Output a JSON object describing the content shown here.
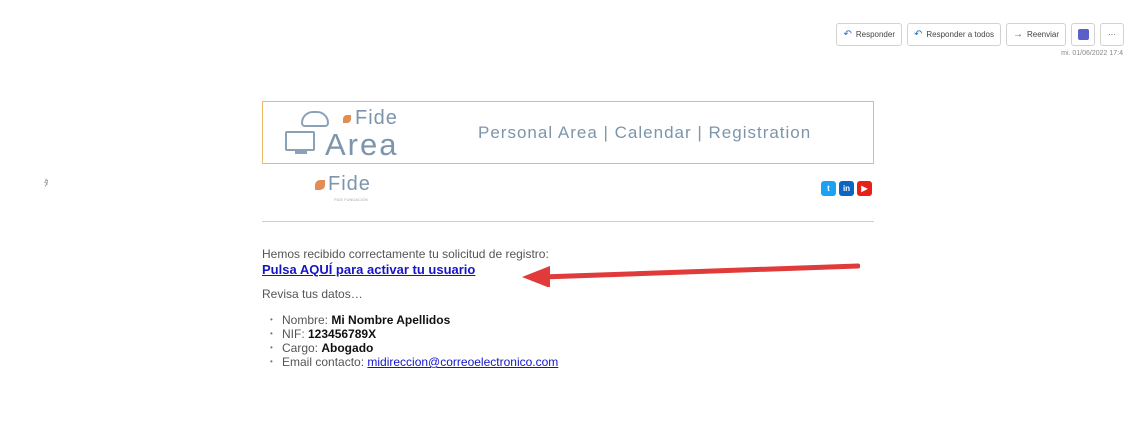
{
  "toolbar": {
    "reply": "Responder",
    "reply_all": "Responder a todos",
    "forward": "Reenviar",
    "more": "···"
  },
  "timestamp": "mi. 01/06/2022 17:4",
  "side_mark": "ﾀ",
  "banner": {
    "logo_top": "Fide",
    "logo_area": "Area",
    "links": "Personal Area | Calendar | Registration"
  },
  "sub_logo": {
    "name": "Fide",
    "tagline": "FIDE FUNDACIÓN"
  },
  "social": [
    {
      "icon": "twitter-icon",
      "glyph": "t",
      "color": "#1da1f2"
    },
    {
      "icon": "linkedin-icon",
      "glyph": "in",
      "color": "#0a66c2"
    },
    {
      "icon": "youtube-icon",
      "glyph": "▶",
      "color": "#e62117"
    }
  ],
  "email": {
    "intro": "Hemos recibido correctamente tu solicitud de registro:",
    "activate_link": "Pulsa AQUÍ para activar tu usuario",
    "review": "Revisa tus datos…",
    "details": [
      {
        "label": "Nombre: ",
        "value": "Mi Nombre Apellidos"
      },
      {
        "label": "NIF: ",
        "value": "123456789X"
      },
      {
        "label": "Cargo: ",
        "value": "Abogado"
      },
      {
        "label": "Email contacto: ",
        "value": "midireccion@correoelectronico.com",
        "is_link": true
      }
    ]
  },
  "colors": {
    "accent_link": "#1515c8",
    "banner_border": "#f0b86a",
    "arrow": "#e03a3a"
  }
}
